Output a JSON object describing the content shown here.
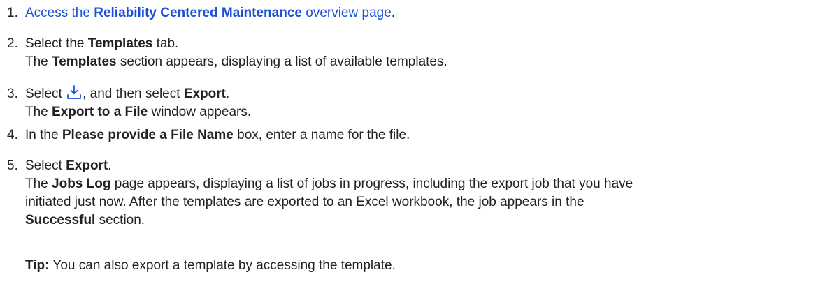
{
  "steps": [
    {
      "num": "1.",
      "link_text": "Access the ",
      "link_bold": "Reliability Centered Maintenance",
      "link_tail": " overview page",
      "after": "."
    },
    {
      "num": "2.",
      "pre": "Select the ",
      "bold": "Templates",
      "post": " tab.",
      "result_bold": "Templates",
      "result": " section appears, displaying a list of available templates.",
      "result_pre": "The "
    },
    {
      "num": "3.",
      "pre": "Select ",
      "icon": "download-icon",
      "mid": ", and then select ",
      "bold": "Export",
      "post": ".",
      "result_pre": "The ",
      "result_bold": "Export to a File",
      "result": " window appears."
    },
    {
      "num": "4.",
      "pre": "In the ",
      "bold": "Please provide a File Name",
      "post": " box, enter a name for the file."
    },
    {
      "num": "5.",
      "pre": "Select ",
      "bold": "Export",
      "post": ".",
      "result_pre": "The ",
      "result_bold": "Jobs Log",
      "result_line1": " page appears, displaying a list of jobs in progress, including the export job that you have",
      "result_line2": "initiated just now. After the templates are exported to an Excel workbook, the job appears in the",
      "result_bold2": "Successful",
      "result_end": " section."
    }
  ],
  "tip": {
    "label": "Tip:",
    "text": " You can also export a template by accessing the template."
  },
  "colors": {
    "link": "#1a4fd8",
    "text": "#222222"
  }
}
